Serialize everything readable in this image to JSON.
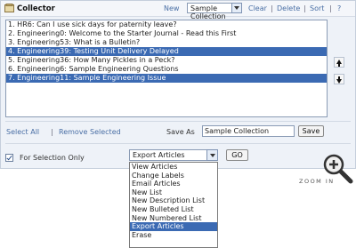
{
  "window": {
    "title": "Collector",
    "toolbar": {
      "new": "New",
      "collection_value": "Sample Collection",
      "clear": "Clear",
      "delete": "Delete",
      "sort": "Sort",
      "help": "?",
      "sep": "|"
    }
  },
  "items": [
    {
      "text": "1. HR6: Can I use sick days for paternity leave?",
      "selected": false
    },
    {
      "text": "2. Engineering0: Welcome to the Starter Journal - Read this First",
      "selected": false
    },
    {
      "text": "3. Engineering53: What is a Bulletin?",
      "selected": false
    },
    {
      "text": "4. Engineering39: Testing Unit Delivery Delayed",
      "selected": true
    },
    {
      "text": "5. Engineering36: How Many Pickles in a Peck?",
      "selected": false
    },
    {
      "text": "6. Engineering6: Sample Engineering Questions",
      "selected": false
    },
    {
      "text": "7. Engineering11: Sample Engineering Issue",
      "selected": true
    }
  ],
  "actions": {
    "select_all": "Select All",
    "sep": "|",
    "remove_selected": "Remove Selected",
    "save_as_label": "Save As",
    "save_as_value": "Sample Collection",
    "save_button": "Save"
  },
  "footer": {
    "for_selection_only": "For Selection Only",
    "action_value": "Export Articles",
    "go_button": "GO",
    "options": [
      "View Articles",
      "Change Labels",
      "Email Articles",
      "New List",
      "New Description List",
      "New Bulleted List",
      "New Numbered List",
      "Export Articles",
      "Erase"
    ],
    "highlighted_option": "Export Articles"
  },
  "zoom": {
    "label": "ZOOM IN"
  },
  "colors": {
    "selection": "#3b6ab3",
    "link": "#4a6fa5",
    "panel": "#eef2f8"
  }
}
